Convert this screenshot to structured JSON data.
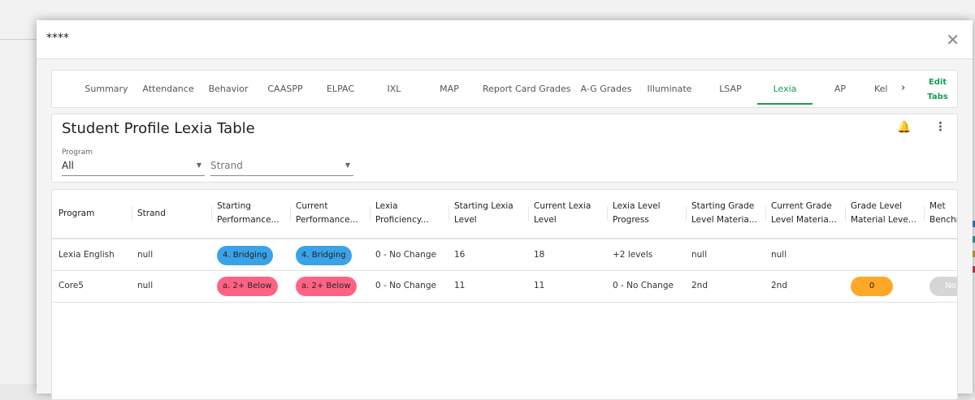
{
  "modal": {
    "title": "****",
    "close": "✕"
  },
  "tabs": {
    "items": [
      "Summary",
      "Attendance",
      "Behavior",
      "CAASPP",
      "ELPAC",
      "IXL",
      "MAP",
      "Report Card Grades",
      "A-G Grades",
      "Illuminate",
      "LSAP",
      "Lexia",
      "AP",
      "Kel"
    ],
    "active": "Lexia",
    "next": "›",
    "edit_line1": "Edit",
    "edit_line2": "Tabs"
  },
  "card": {
    "title": "Student Profile Lexia Table",
    "bell_icon": "🔔",
    "menu_icon": "⋮",
    "program_label": "Program",
    "program_value": "All",
    "strand_placeholder": "Strand"
  },
  "table": {
    "headers": [
      [
        "Program",
        ""
      ],
      [
        "Strand",
        ""
      ],
      [
        "Starting",
        "Performance..."
      ],
      [
        "Current",
        "Performance..."
      ],
      [
        "Lexia",
        "Proficiency..."
      ],
      [
        "Starting Lexia",
        "Level"
      ],
      [
        "Current Lexia",
        "Level"
      ],
      [
        "Lexia Level",
        "Progress"
      ],
      [
        "Starting Grade",
        "Level Materia..."
      ],
      [
        "Current Grade",
        "Level Materia..."
      ],
      [
        "Grade Level",
        "Material Leve..."
      ],
      [
        "Met",
        "Benchr"
      ]
    ],
    "rows": [
      [
        "Lexia English",
        "null",
        "4. Bridging",
        "4. Bridging",
        "0 - No Change",
        "16",
        "18",
        "+2 levels",
        "null",
        "null",
        "",
        ""
      ],
      [
        "Core5",
        "null",
        "a. 2+ Below",
        "a. 2+ Below",
        "0 - No Change",
        "11",
        "11",
        "0 - No Change",
        "2nd",
        "2nd",
        "0",
        "No"
      ]
    ],
    "pill_colors": {
      "4. Bridging": "#3aa3e8",
      "a. 2+ Below": "#ff6384",
      "0": "#ffa726",
      "No": "#d6d6d6"
    }
  }
}
